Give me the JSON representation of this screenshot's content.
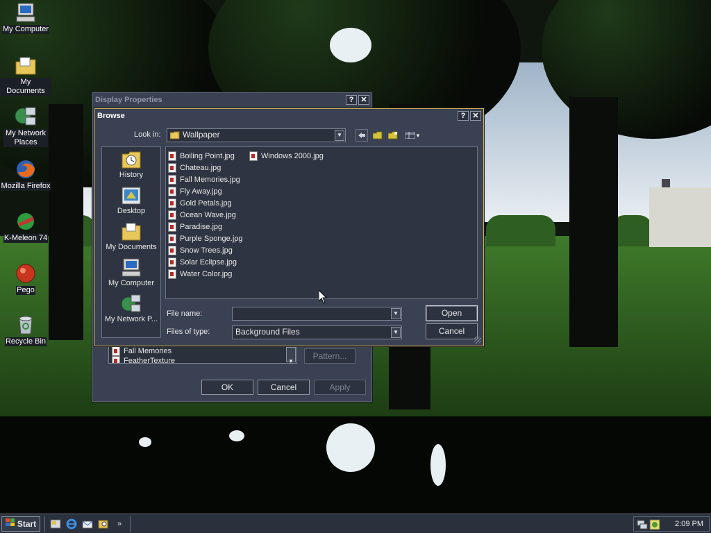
{
  "desktop": {
    "icons": [
      {
        "label": "My Computer",
        "icon": "computer-icon"
      },
      {
        "label": "My Documents",
        "icon": "folder-icon"
      },
      {
        "label": "My Network Places",
        "icon": "network-icon"
      },
      {
        "label": "Mozilla Firefox",
        "icon": "firefox-icon"
      },
      {
        "label": "K-Meleon 74",
        "icon": "kmeleon-icon"
      },
      {
        "label": "Pego",
        "icon": "pego-icon"
      },
      {
        "label": "Recycle Bin",
        "icon": "recycle-bin-icon"
      }
    ]
  },
  "display_properties": {
    "title": "Display Properties",
    "help_label": "?",
    "close_label": "✕",
    "wallpaper_items": [
      "Fall Memories",
      "FeatherTexture"
    ],
    "pattern_label": "Pattern...",
    "ok_label": "OK",
    "cancel_label": "Cancel",
    "apply_label": "Apply"
  },
  "browse": {
    "title": "Browse",
    "help_label": "?",
    "close_label": "✕",
    "look_in_label": "Look in:",
    "look_in_value": "Wallpaper",
    "places": [
      "History",
      "Desktop",
      "My Documents",
      "My Computer",
      "My Network P..."
    ],
    "files_col1": [
      "Boiling Point.jpg",
      "Chateau.jpg",
      "Fall Memories.jpg",
      "Fly Away.jpg",
      "Gold Petals.jpg",
      "Ocean Wave.jpg",
      "Paradise.jpg",
      "Purple Sponge.jpg",
      "Snow Trees.jpg",
      "Solar Eclipse.jpg",
      "Water Color.jpg"
    ],
    "files_col2": [
      "Windows 2000.jpg"
    ],
    "file_name_label": "File name:",
    "file_name_value": "",
    "files_of_type_label": "Files of type:",
    "files_of_type_value": "Background Files",
    "open_label": "Open",
    "cancel_label": "Cancel"
  },
  "taskbar": {
    "start_label": "Start",
    "chevron": "»",
    "clock": "2:09 PM"
  }
}
